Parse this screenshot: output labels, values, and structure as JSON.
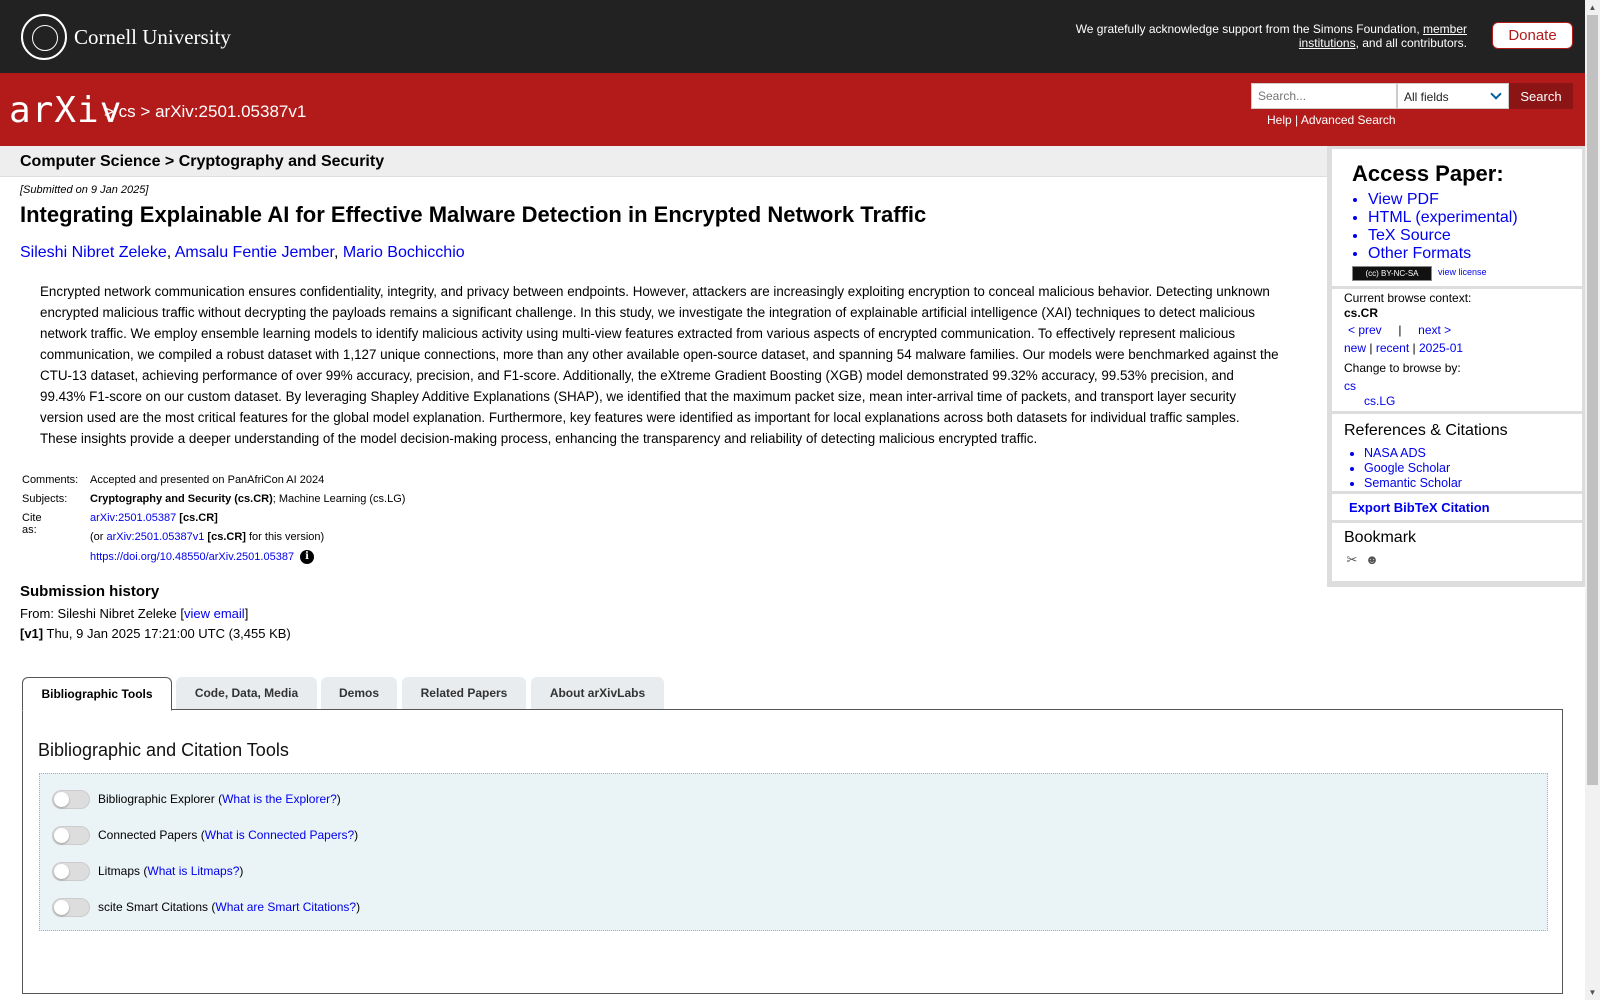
{
  "cornell": {
    "name": "Cornell University",
    "support_prefix": "We gratefully acknowledge support from the Simons Foundation, ",
    "support_link1": "member institutions",
    "support_suffix": ", and all contributors.",
    "donate": "Donate"
  },
  "header": {
    "logo": "arXiv",
    "sep1": ">",
    "crumb_cs": "cs",
    "sep2": ">",
    "crumb_id": "arXiv:2501.05387v1",
    "search_placeholder": "Search...",
    "search_field": "All fields",
    "search_button": "Search",
    "help": "Help",
    "help_sep": "|",
    "advanced": "Advanced Search"
  },
  "subheader": {
    "title": "Computer Science > Cryptography and Security"
  },
  "paper": {
    "submitted": "[Submitted on 9 Jan 2025]",
    "title": "Integrating Explainable AI for Effective Malware Detection in Encrypted Network Traffic",
    "authors": [
      "Sileshi Nibret Zeleke",
      "Amsalu Fentie Jember",
      "Mario Bochicchio"
    ],
    "abstract": "Encrypted network communication ensures confidentiality, integrity, and privacy between endpoints. However, attackers are increasingly exploiting encryption to conceal malicious behavior. Detecting unknown encrypted malicious traffic without decrypting the payloads remains a significant challenge. In this study, we investigate the integration of explainable artificial intelligence (XAI) techniques to detect malicious network traffic. We employ ensemble learning models to identify malicious activity using multi-view features extracted from various aspects of encrypted communication. To effectively represent malicious communication, we compiled a robust dataset with 1,127 unique connections, more than any other available open-source dataset, and spanning 54 malware families. Our models were benchmarked against the CTU-13 dataset, achieving performance of over 99% accuracy, precision, and F1-score. Additionally, the eXtreme Gradient Boosting (XGB) model demonstrated 99.32% accuracy, 99.53% precision, and 99.43% F1-score on our custom dataset. By leveraging Shapley Additive Explanations (SHAP), we identified that the maximum packet size, mean inter-arrival time of packets, and transport layer security version used are the most critical features for the global model explanation. Furthermore, key features were identified as important for local explanations across both datasets for individual traffic samples. These insights provide a deeper understanding of the model decision-making process, enhancing the transparency and reliability of detecting malicious encrypted traffic."
  },
  "meta": {
    "comments_label": "Comments:",
    "comments": "Accepted and presented on PanAfriCon AI 2024",
    "subjects_label": "Subjects:",
    "subjects_primary": "Cryptography and Security (cs.CR)",
    "subjects_rest": "; Machine Learning (cs.LG)",
    "cite_label": "Cite as:",
    "cite_id": "arXiv:2501.05387",
    "cite_cat": "[cs.CR]",
    "or_prefix": "(or ",
    "cite_version": "arXiv:2501.05387v1",
    "cite_version_cat": "[cs.CR]",
    "or_suffix": " for this version)",
    "doi": "https://doi.org/10.48550/arXiv.2501.05387",
    "info_glyph": "i"
  },
  "history": {
    "title": "Submission history",
    "from_prefix": "From: Sileshi Nibret Zeleke [",
    "view_email": "view email",
    "from_suffix": "]",
    "v1_label": "[v1]",
    "v1_text": " Thu, 9 Jan 2025 17:21:00 UTC (3,455 KB)"
  },
  "tabs": [
    {
      "label": "Bibliographic Tools"
    },
    {
      "label": "Code, Data, Media"
    },
    {
      "label": "Demos"
    },
    {
      "label": "Related Papers"
    },
    {
      "label": "About arXivLabs"
    }
  ],
  "panel": {
    "title": "Bibliographic and Citation Tools",
    "tools": [
      {
        "name": "Bibliographic Explorer",
        "link": "What is the Explorer?"
      },
      {
        "name": "Connected Papers",
        "link": "What is Connected Papers?"
      },
      {
        "name": "Litmaps",
        "link": "What is Litmaps?"
      },
      {
        "name": "scite Smart Citations",
        "link": "What are Smart Citations?"
      }
    ]
  },
  "sidebar": {
    "access_title": "Access Paper:",
    "access_links": [
      "View PDF",
      "HTML (experimental)",
      "TeX Source",
      "Other Formats"
    ],
    "license_badge": "(cc) BY-NC-SA",
    "view_license": "view license",
    "browse_context_label": "Current browse context:",
    "browse_context": "cs.CR",
    "prev": "< prev",
    "pipe": "|",
    "next": "next >",
    "new": "new",
    "recent": "recent",
    "month": "2025-01",
    "change_label": "Change to browse by:",
    "change_cs": "cs",
    "change_lg": "cs.LG",
    "refs_title": "References & Citations",
    "refs": [
      "NASA ADS",
      "Google Scholar",
      "Semantic Scholar"
    ],
    "bibtex": "Export BibTeX Citation",
    "bookmark_title": "Bookmark"
  },
  "colors": {
    "arxiv_red": "#b31b1b",
    "cornell_dark": "#222222",
    "link": "#0000ee"
  }
}
